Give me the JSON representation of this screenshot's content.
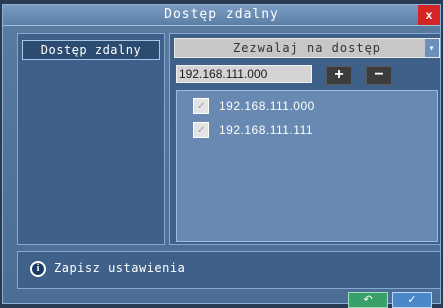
{
  "window": {
    "title": "Dostęp zdalny",
    "close_label": "x"
  },
  "sidebar": {
    "items": [
      {
        "label": "Dostęp zdalny"
      }
    ]
  },
  "main": {
    "mode_select": {
      "value": "Zezwalaj na dostęp"
    },
    "ip_field": {
      "value": "192.168.111.000"
    },
    "add_label": "+",
    "remove_label": "−",
    "ip_list": [
      {
        "ip": "192.168.111.000",
        "checked": true
      },
      {
        "ip": "192.168.111.111",
        "checked": true
      }
    ]
  },
  "status": {
    "text": "Zapisz ustawienia"
  },
  "colors": {
    "panel": "#3f6189",
    "border": "#84a8cf",
    "close": "#d42424"
  },
  "icons": [
    "info-icon",
    "checkbox-icon",
    "dropdown-arrow-icon",
    "close-icon",
    "back-icon",
    "confirm-icon"
  ]
}
